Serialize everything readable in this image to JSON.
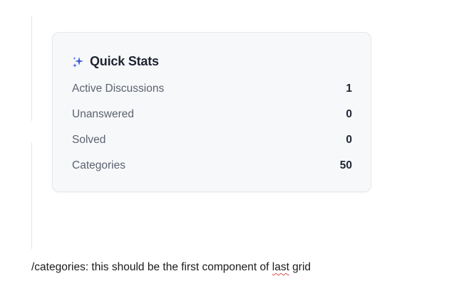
{
  "quick_stats": {
    "title": "Quick Stats",
    "icon": "sparkle-icon",
    "accent": "#3b5bdb",
    "rows": [
      {
        "label": "Active Discussions",
        "value": "1"
      },
      {
        "label": "Unanswered",
        "value": "0"
      },
      {
        "label": "Solved",
        "value": "0"
      },
      {
        "label": "Categories",
        "value": "50"
      }
    ]
  },
  "note": {
    "before": "/categories: this should be the first component of ",
    "flagged_word": "last",
    "after": " grid"
  }
}
